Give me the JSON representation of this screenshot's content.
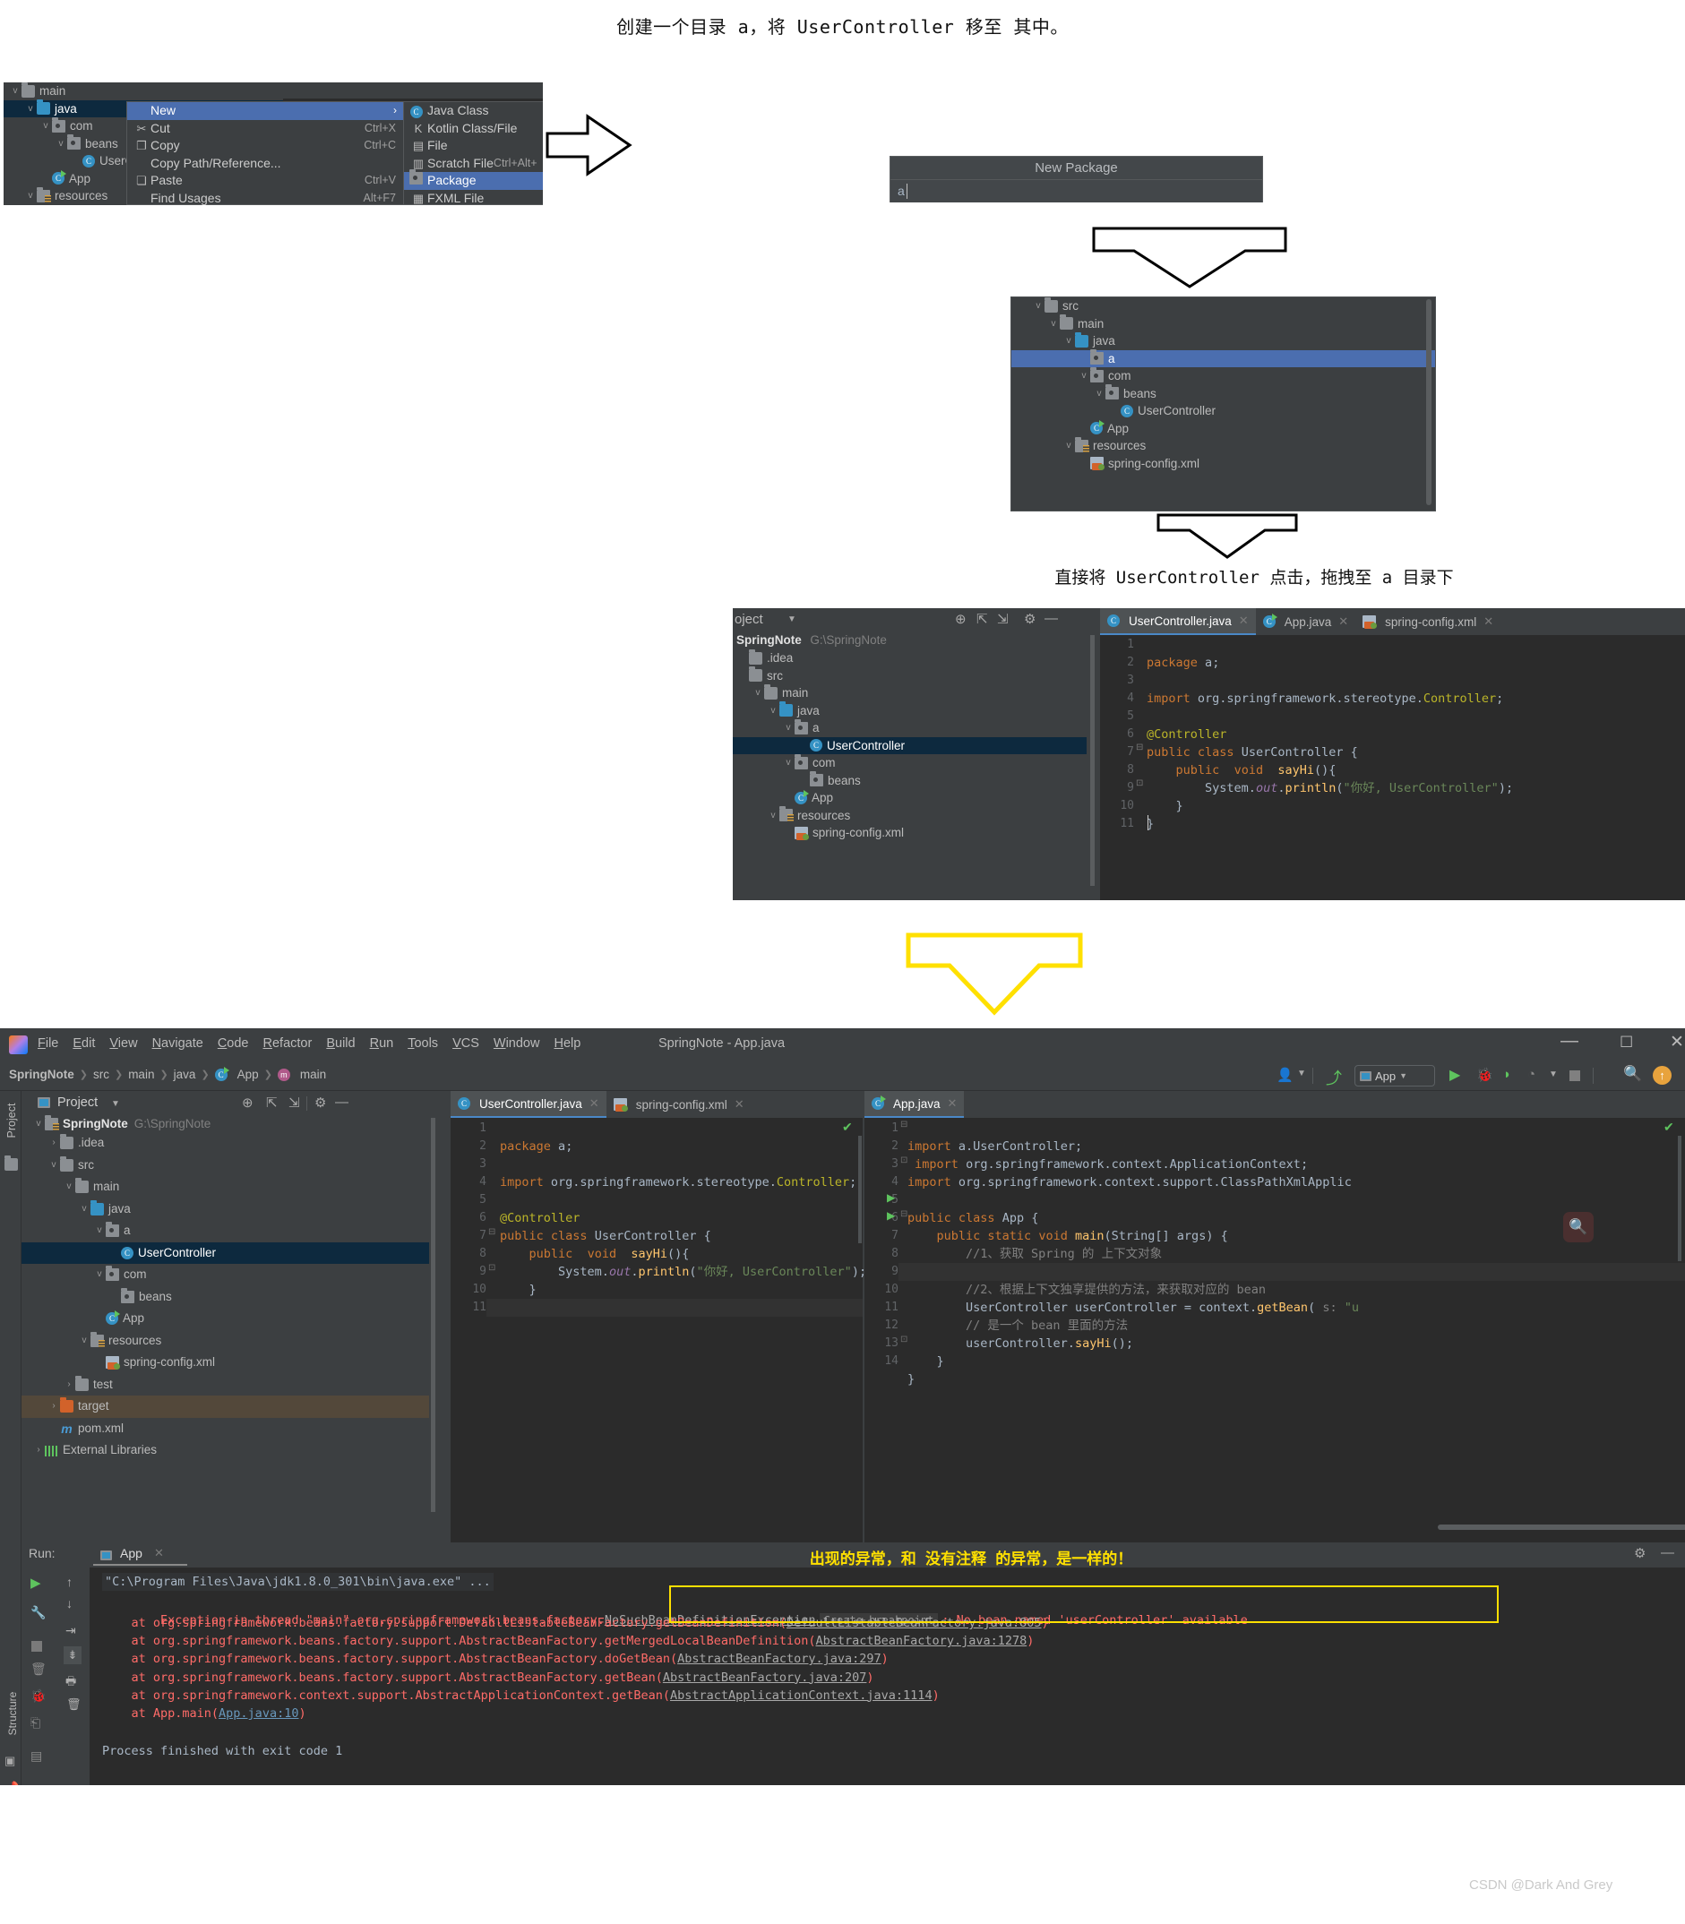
{
  "captions": {
    "top": "创建一个目录 a，将 UserController 移至 其中。",
    "drag": "直接将 UserController 点击，拖拽至 a 目录下",
    "exception_note": "出现的异常，和 没有注释 的异常，是一样的！"
  },
  "footer": {
    "watermark": "CSDN @Dark And Grey"
  },
  "panel_ctx": {
    "tree": [
      {
        "label": "main",
        "icon": "folder-icon",
        "indent": 0,
        "chevron": "v",
        "state": ""
      },
      {
        "label": "java",
        "icon": "folder-blue-icon",
        "indent": 1,
        "chevron": "v",
        "state": "sel-dark"
      },
      {
        "label": "com",
        "icon": "package-icon",
        "indent": 2,
        "chevron": "v",
        "state": ""
      },
      {
        "label": "beans",
        "icon": "package-icon",
        "indent": 3,
        "chevron": "v",
        "state": ""
      },
      {
        "label": "UserCo",
        "icon": "java-class-icon",
        "indent": 4,
        "chevron": "",
        "state": ""
      },
      {
        "label": "App",
        "icon": "java-app-icon",
        "indent": 2,
        "chevron": "",
        "state": ""
      },
      {
        "label": "resources",
        "icon": "resources-icon",
        "indent": 1,
        "chevron": "v",
        "state": ""
      }
    ],
    "menu": [
      {
        "label": "New",
        "accel": "",
        "icon": "",
        "submenu": true,
        "highlight": true
      },
      {
        "label": "Cut",
        "accel": "Ctrl+X",
        "icon": "scissors-icon",
        "submenu": false,
        "highlight": false
      },
      {
        "label": "Copy",
        "accel": "Ctrl+C",
        "icon": "copy-icon",
        "submenu": false,
        "highlight": false
      },
      {
        "label": "Copy Path/Reference...",
        "accel": "",
        "icon": "",
        "submenu": false,
        "highlight": false
      },
      {
        "label": "Paste",
        "accel": "Ctrl+V",
        "icon": "clipboard-icon",
        "submenu": false,
        "highlight": false
      },
      {
        "label": "Find Usages",
        "accel": "Alt+F7",
        "icon": "",
        "submenu": false,
        "highlight": false
      }
    ],
    "submenu": [
      {
        "label": "Java Class",
        "accel": "",
        "icon": "java-class-icon",
        "highlight": false
      },
      {
        "label": "Kotlin Class/File",
        "accel": "",
        "icon": "kotlin-icon",
        "highlight": false
      },
      {
        "label": "File",
        "accel": "",
        "icon": "file-icon",
        "highlight": false
      },
      {
        "label": "Scratch File",
        "accel": "Ctrl+Alt+",
        "icon": "scratch-file-icon",
        "highlight": false
      },
      {
        "label": "Package",
        "accel": "",
        "icon": "package-icon",
        "highlight": true
      },
      {
        "label": "FXML File",
        "accel": "",
        "icon": "fxml-icon",
        "highlight": false
      }
    ]
  },
  "new_package_dialog": {
    "title": "New Package",
    "value": "a",
    "placeholder": ""
  },
  "panel_tree_after": [
    {
      "label": "src",
      "icon": "folder-icon",
      "indent": 1,
      "chevron": "v",
      "state": ""
    },
    {
      "label": "main",
      "icon": "folder-icon",
      "indent": 2,
      "chevron": "v",
      "state": ""
    },
    {
      "label": "java",
      "icon": "folder-blue-icon",
      "indent": 3,
      "chevron": "v",
      "state": ""
    },
    {
      "label": "a",
      "icon": "package-icon",
      "indent": 4,
      "chevron": "",
      "state": "sel-blue"
    },
    {
      "label": "com",
      "icon": "package-icon",
      "indent": 4,
      "chevron": "v",
      "state": ""
    },
    {
      "label": "beans",
      "icon": "package-icon",
      "indent": 5,
      "chevron": "v",
      "state": ""
    },
    {
      "label": "UserController",
      "icon": "java-class-icon",
      "indent": 6,
      "chevron": "",
      "state": ""
    },
    {
      "label": "App",
      "icon": "java-app-icon",
      "indent": 4,
      "chevron": "",
      "state": ""
    },
    {
      "label": "resources",
      "icon": "resources-icon",
      "indent": 3,
      "chevron": "v",
      "state": ""
    },
    {
      "label": "spring-config.xml",
      "icon": "xml-spring-icon",
      "indent": 4,
      "chevron": "",
      "state": ""
    }
  ],
  "mid_ide": {
    "project_label": "oject",
    "toolbar_icons": [
      "locate-icon",
      "expand-all-icon",
      "collapse-all-icon",
      "gear-icon",
      "minimize-icon"
    ],
    "root": {
      "name": "SpringNote",
      "path": "G:\\SpringNote"
    },
    "tree": [
      {
        "label": ".idea",
        "icon": "folder-icon",
        "indent": 0,
        "chevron": "",
        "state": ""
      },
      {
        "label": "src",
        "icon": "folder-icon",
        "indent": 0,
        "chevron": "",
        "state": ""
      },
      {
        "label": "main",
        "icon": "folder-icon",
        "indent": 1,
        "chevron": "v",
        "state": ""
      },
      {
        "label": "java",
        "icon": "folder-blue-icon",
        "indent": 2,
        "chevron": "v",
        "state": ""
      },
      {
        "label": "a",
        "icon": "package-icon",
        "indent": 3,
        "chevron": "v",
        "state": ""
      },
      {
        "label": "UserController",
        "icon": "java-class-icon",
        "indent": 4,
        "chevron": "",
        "state": "sel-dark"
      },
      {
        "label": "com",
        "icon": "package-icon",
        "indent": 3,
        "chevron": "v",
        "state": ""
      },
      {
        "label": "beans",
        "icon": "package-icon",
        "indent": 4,
        "chevron": "",
        "state": ""
      },
      {
        "label": "App",
        "icon": "java-app-icon",
        "indent": 3,
        "chevron": "",
        "state": ""
      },
      {
        "label": "resources",
        "icon": "resources-icon",
        "indent": 2,
        "chevron": "v",
        "state": ""
      },
      {
        "label": "spring-config.xml",
        "icon": "xml-spring-icon",
        "indent": 3,
        "chevron": "",
        "state": ""
      }
    ],
    "tabs": [
      {
        "label": "UserController.java",
        "icon": "java-class-icon",
        "active": true
      },
      {
        "label": "App.java",
        "icon": "java-app-icon",
        "active": false
      },
      {
        "label": "spring-config.xml",
        "icon": "xml-spring-icon",
        "active": false
      }
    ],
    "code_lines": [
      "1",
      "2",
      "3",
      "4",
      "5",
      "6",
      "7",
      "8",
      "9",
      "10",
      "11"
    ]
  },
  "main_window": {
    "title": "SpringNote - App.java",
    "menus": [
      "File",
      "Edit",
      "View",
      "Navigate",
      "Code",
      "Refactor",
      "Build",
      "Run",
      "Tools",
      "VCS",
      "Window",
      "Help"
    ],
    "window_controls": [
      "minimize",
      "maximize",
      "close"
    ],
    "breadcrumb": [
      "SpringNote",
      "src",
      "main",
      "java",
      "App",
      "main"
    ],
    "run_config": "App",
    "toolbar_right_icons": [
      "user-icon",
      "update-icon",
      "run-config-selector",
      "run-icon",
      "debug-icon",
      "coverage-icon",
      "profiler-icon",
      "stop-icon",
      "search-icon",
      "update-project-icon"
    ],
    "project_panel": {
      "title": "Project",
      "sidebar_label": "Project",
      "root": {
        "name": "SpringNote",
        "path": "G:\\SpringNote"
      },
      "tree": [
        {
          "label": ".idea",
          "icon": "folder-icon",
          "indent": 1,
          "chevron": ">",
          "state": ""
        },
        {
          "label": "src",
          "icon": "folder-icon",
          "indent": 1,
          "chevron": "v",
          "state": ""
        },
        {
          "label": "main",
          "icon": "folder-icon",
          "indent": 2,
          "chevron": "v",
          "state": ""
        },
        {
          "label": "java",
          "icon": "folder-blue-icon",
          "indent": 3,
          "chevron": "v",
          "state": ""
        },
        {
          "label": "a",
          "icon": "package-icon",
          "indent": 4,
          "chevron": "v",
          "state": ""
        },
        {
          "label": "UserController",
          "icon": "java-class-icon",
          "indent": 5,
          "chevron": "",
          "state": "sel-dark"
        },
        {
          "label": "com",
          "icon": "package-icon",
          "indent": 4,
          "chevron": "v",
          "state": ""
        },
        {
          "label": "beans",
          "icon": "package-icon",
          "indent": 5,
          "chevron": "",
          "state": ""
        },
        {
          "label": "App",
          "icon": "java-app-icon",
          "indent": 4,
          "chevron": "",
          "state": ""
        },
        {
          "label": "resources",
          "icon": "resources-icon",
          "indent": 3,
          "chevron": "v",
          "state": ""
        },
        {
          "label": "spring-config.xml",
          "icon": "xml-spring-icon",
          "indent": 4,
          "chevron": "",
          "state": ""
        },
        {
          "label": "test",
          "icon": "folder-icon",
          "indent": 2,
          "chevron": ">",
          "state": ""
        },
        {
          "label": "target",
          "icon": "folder-orange-icon",
          "indent": 1,
          "chevron": ">",
          "state": "sel-brown"
        },
        {
          "label": "pom.xml",
          "icon": "maven-icon",
          "indent": 1,
          "chevron": "",
          "state": ""
        },
        {
          "label": "External Libraries",
          "icon": "libraries-icon",
          "indent": 0,
          "chevron": ">",
          "state": ""
        }
      ]
    },
    "editor_left": {
      "tabs": [
        {
          "label": "UserController.java",
          "icon": "java-class-icon",
          "active": true
        },
        {
          "label": "spring-config.xml",
          "icon": "xml-spring-icon",
          "active": false
        }
      ],
      "line_numbers": [
        "1",
        "2",
        "3",
        "4",
        "5",
        "6",
        "7",
        "8",
        "9",
        "10",
        "11"
      ]
    },
    "editor_right": {
      "tabs": [
        {
          "label": "App.java",
          "icon": "java-app-icon",
          "active": true
        }
      ],
      "line_numbers": [
        "1",
        "2",
        "3",
        "4",
        "5",
        "6",
        "7",
        "8",
        "9",
        "10",
        "11",
        "12",
        "13",
        "14"
      ]
    },
    "run_panel": {
      "label": "Run:",
      "tab": "App",
      "command": "\"C:\\Program Files\\Java\\jdk1.8.0_301\\bin\\java.exe\" ...",
      "exception_head": "Exception in thread \"main\" org.springframework.beans.factory.",
      "exception_type": "NoSuchBeanDefinitionException",
      "breakpoint_hint": "Create breakpoint",
      "exception_msg": ": No bean named 'userController' available",
      "stack": [
        {
          "pre": "    at org.springframework.beans.factory.support.DefaultListableBeanFactory.getBeanDefinition(",
          "link": "DefaultListableBeanFactory.java:805",
          "post": ")"
        },
        {
          "pre": "    at org.springframework.beans.factory.support.AbstractBeanFactory.getMergedLocalBeanDefinition(",
          "link": "AbstractBeanFactory.java:1278",
          "post": ")"
        },
        {
          "pre": "    at org.springframework.beans.factory.support.AbstractBeanFactory.doGetBean(",
          "link": "AbstractBeanFactory.java:297",
          "post": ")"
        },
        {
          "pre": "    at org.springframework.beans.factory.support.AbstractBeanFactory.getBean(",
          "link": "AbstractBeanFactory.java:207",
          "post": ")"
        },
        {
          "pre": "    at org.springframework.context.support.AbstractApplicationContext.getBean(",
          "link": "AbstractApplicationContext.java:1114",
          "post": ")"
        },
        {
          "pre": "    at App.main(",
          "link": "App.java:10",
          "post": ")"
        }
      ],
      "finished": "Process finished with exit code 1",
      "left_icons": [
        "run-icon",
        "wrench-icon",
        "stop-icon",
        "trash-icon",
        "debug-rerun-icon",
        "export-icon",
        "layout-icon"
      ],
      "nav_icons": [
        "arrow-up-icon",
        "arrow-down-icon",
        "soft-wrap-icon",
        "scroll-to-end-icon",
        "print-icon",
        "clear-all-icon"
      ],
      "right_icons": [
        "gear-icon",
        "minimize-icon"
      ],
      "status_bar_label": "Structure"
    }
  }
}
